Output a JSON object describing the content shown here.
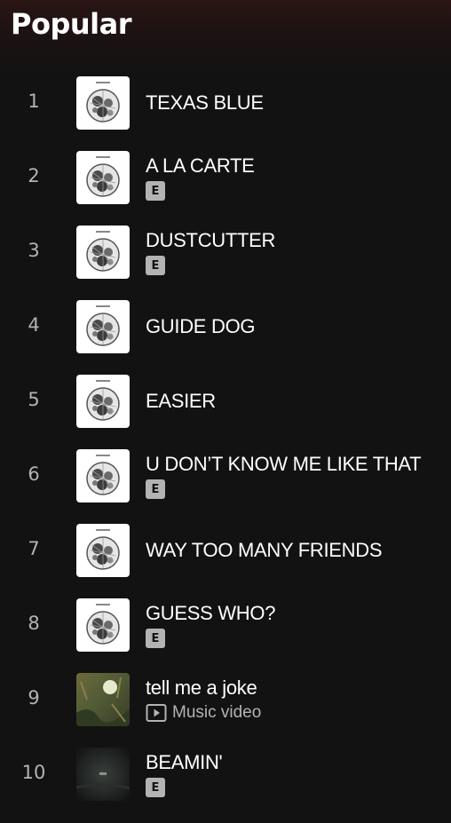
{
  "header": {
    "title": "Popular"
  },
  "tracks": [
    {
      "number": "1",
      "title": "TEXAS BLUE",
      "explicit": false,
      "art": "carte"
    },
    {
      "number": "2",
      "title": "A LA CARTE",
      "explicit": true,
      "explicit_label": "E",
      "art": "carte"
    },
    {
      "number": "3",
      "title": "DUSTCUTTER",
      "explicit": true,
      "explicit_label": "E",
      "art": "carte"
    },
    {
      "number": "4",
      "title": "GUIDE DOG",
      "explicit": false,
      "art": "carte"
    },
    {
      "number": "5",
      "title": "EASIER",
      "explicit": false,
      "art": "carte"
    },
    {
      "number": "6",
      "title": "U DON’T KNOW ME LIKE THAT",
      "explicit": true,
      "explicit_label": "E",
      "art": "carte"
    },
    {
      "number": "7",
      "title": "WAY TOO MANY FRIENDS",
      "explicit": false,
      "art": "carte"
    },
    {
      "number": "8",
      "title": "GUESS WHO?",
      "explicit": true,
      "explicit_label": "E",
      "art": "carte"
    },
    {
      "number": "9",
      "title": "tell me a joke",
      "explicit": false,
      "music_video_label": "Music video",
      "art": "forest"
    },
    {
      "number": "10",
      "title": "BEAMIN'",
      "explicit": true,
      "explicit_label": "E",
      "art": "dark"
    }
  ],
  "colors": {
    "background": "#121212",
    "header_gradient_top": "#2a1513",
    "primary_text": "#ffffff",
    "secondary_text": "#b3b3b3",
    "explicit_badge": "#b3b3b3"
  },
  "icons": {
    "music_video": "play-box-icon",
    "explicit": "explicit-badge-icon"
  }
}
